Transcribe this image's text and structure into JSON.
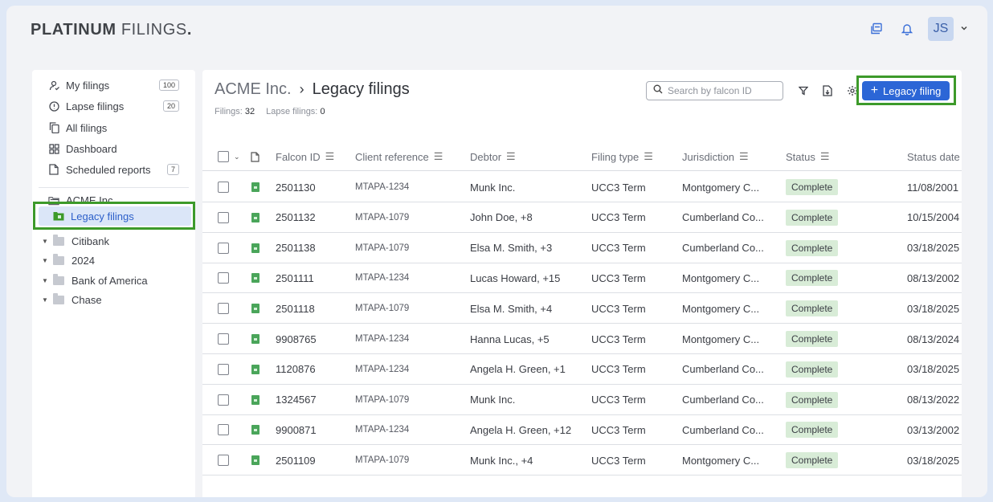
{
  "app": {
    "logo_bold": "PLATINUM",
    "logo_thin": "FILINGS",
    "logo_dot": ".",
    "avatar_initials": "JS"
  },
  "sidebar": {
    "items": [
      {
        "label": "My filings",
        "icon": "user-icon",
        "badge": "100"
      },
      {
        "label": "Lapse filings",
        "icon": "alert-circle-icon",
        "badge": "20"
      },
      {
        "label": "All filings",
        "icon": "copy-icon",
        "badge": ""
      },
      {
        "label": "Dashboard",
        "icon": "dashboard-icon",
        "badge": ""
      },
      {
        "label": "Scheduled reports",
        "icon": "report-icon",
        "badge": "7"
      }
    ],
    "org": "ACME Inc.",
    "selected": "Legacy filings",
    "folders": [
      "Citibank",
      "2024",
      "Bank of America",
      "Chase"
    ]
  },
  "main": {
    "breadcrumb_parent": "ACME Inc.",
    "breadcrumb_current": "Legacy filings",
    "filings_label": "Filings:",
    "filings_count": "32",
    "lapse_label": "Lapse filings:",
    "lapse_count": "0",
    "search_placeholder": "Search by falcon ID",
    "add_button": "Legacy filing"
  },
  "table": {
    "columns": [
      "Falcon ID",
      "Client reference",
      "Debtor",
      "Filing type",
      "Jurisdiction",
      "Status",
      "Status date"
    ],
    "rows": [
      [
        "2501130",
        "MTAPA-1234",
        "Munk Inc.",
        "UCC3 Term",
        "Montgomery C...",
        "Complete",
        "11/08/2001"
      ],
      [
        "2501132",
        "MTAPA-1079",
        "John Doe, +8",
        "UCC3 Term",
        "Cumberland Co...",
        "Complete",
        "10/15/2004"
      ],
      [
        "2501138",
        "MTAPA-1079",
        "Elsa M. Smith, +3",
        "UCC3 Term",
        "Cumberland Co...",
        "Complete",
        "03/18/2025"
      ],
      [
        "2501111",
        "MTAPA-1234",
        "Lucas Howard, +15",
        "UCC3 Term",
        "Montgomery C...",
        "Complete",
        "08/13/2002"
      ],
      [
        "2501118",
        "MTAPA-1079",
        "Elsa M. Smith, +4",
        "UCC3 Term",
        "Montgomery C...",
        "Complete",
        "03/18/2025"
      ],
      [
        "9908765",
        "MTAPA-1234",
        "Hanna Lucas, +5",
        "UCC3 Term",
        "Montgomery C...",
        "Complete",
        "08/13/2024"
      ],
      [
        "1120876",
        "MTAPA-1234",
        "Angela H. Green, +1",
        "UCC3 Term",
        "Cumberland Co...",
        "Complete",
        "03/18/2025"
      ],
      [
        "1324567",
        "MTAPA-1079",
        "Munk Inc.",
        "UCC3 Term",
        "Cumberland Co...",
        "Complete",
        "08/13/2022"
      ],
      [
        "9900871",
        "MTAPA-1234",
        "Angela H. Green, +12",
        "UCC3 Term",
        "Cumberland Co...",
        "Complete",
        "03/13/2002"
      ],
      [
        "2501109",
        "MTAPA-1079",
        "Munk Inc., +4",
        "UCC3 Term",
        "Montgomery C...",
        "Complete",
        "03/18/2025"
      ]
    ]
  },
  "colors": {
    "accent": "#2c66d6",
    "highlight": "#3d9a2a",
    "status_bg": "#d8ecd7"
  }
}
